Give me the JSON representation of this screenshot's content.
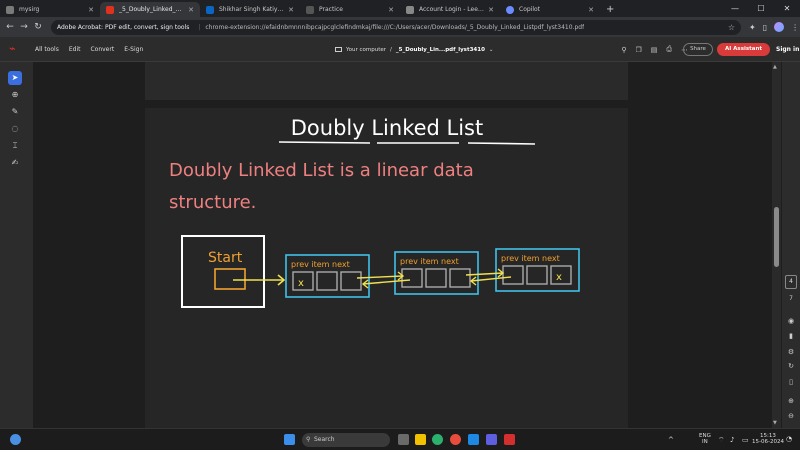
{
  "tabs": [
    {
      "label": "mysirg",
      "color": "#7a7a7a"
    },
    {
      "label": "_5_Doubly_Linked_Listpdf_lyst3",
      "color": "#e0301e"
    },
    {
      "label": "Shikhar Singh Katiyar | LinkedIn",
      "color": "#0a66c2"
    },
    {
      "label": "Practice",
      "color": "#555555"
    },
    {
      "label": "Account Login - LeetCode",
      "color": "#888888"
    },
    {
      "label": "Copilot",
      "color": "#6a8cff"
    }
  ],
  "address": {
    "site": "Adobe Acrobat: PDF edit, convert, sign tools",
    "url": "chrome-extension://efaidnbmnnnibpcajpcglclefindmkaj/file:///C:/Users/acer/Downloads/_5_Doubly_Linked_Listpdf_lyst3410.pdf"
  },
  "acrobat": {
    "menu": [
      "All tools",
      "Edit",
      "Convert",
      "E-Sign"
    ],
    "location": "Your computer",
    "docname": "_5_Doubly_Lin...pdf_lyst3410",
    "share": "Share",
    "ai": "AI Assistant",
    "signin": "Sign in"
  },
  "page": {
    "title": "Doubly Linked List",
    "line1": "Doubly Linked List is a linear data",
    "line2": "structure.",
    "start": "Start",
    "node_label": "prev item next",
    "null_mark": "x"
  },
  "pager": {
    "current": "4",
    "total": "7"
  },
  "taskbar": {
    "search": "Search",
    "lang1": "ENG",
    "lang2": "IN",
    "time": "15:13",
    "date": "15-06-2024"
  }
}
